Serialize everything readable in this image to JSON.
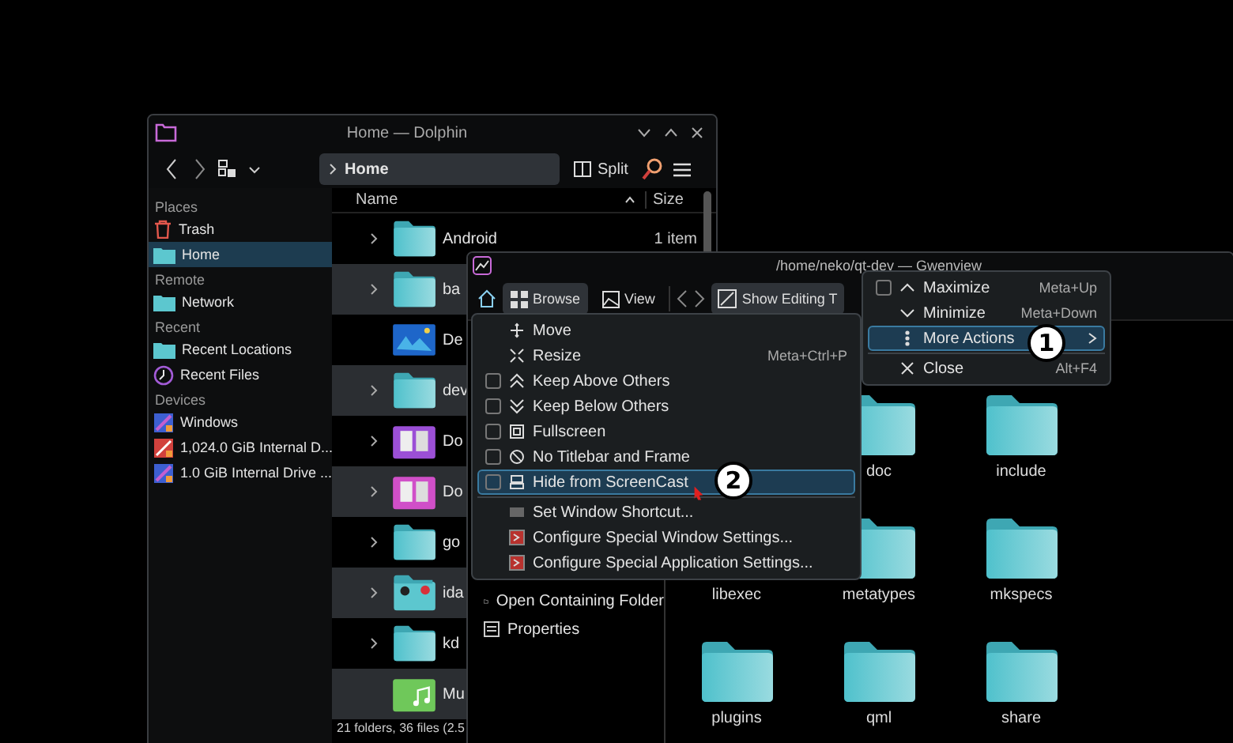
{
  "dolphin": {
    "title": "Home — Dolphin",
    "location": "Home",
    "split": "Split",
    "sidebar": [
      {
        "heading": "Places",
        "items": [
          {
            "label": "Trash",
            "kind": "trash",
            "selected": false
          },
          {
            "label": "Home",
            "kind": "folder",
            "selected": true
          }
        ]
      },
      {
        "heading": "Remote",
        "items": [
          {
            "label": "Network",
            "kind": "folder",
            "selected": false
          }
        ]
      },
      {
        "heading": "Recent",
        "items": [
          {
            "label": "Recent Locations",
            "kind": "folder",
            "selected": false
          },
          {
            "label": "Recent Files",
            "kind": "clock",
            "selected": false
          }
        ]
      },
      {
        "heading": "Devices",
        "items": [
          {
            "label": "Windows",
            "kind": "drive",
            "selected": false
          },
          {
            "label": "1,024.0 GiB Internal D...",
            "kind": "drive-red",
            "selected": false
          },
          {
            "label": "1.0 GiB Internal Drive ...",
            "kind": "drive",
            "selected": false
          }
        ]
      }
    ],
    "columns": [
      "Name",
      "Size"
    ],
    "rows": [
      {
        "name": "Android",
        "size": "1 item",
        "kind": "folder",
        "expandable": true
      },
      {
        "name": "ba",
        "kind": "folder",
        "expandable": true
      },
      {
        "name": "De",
        "kind": "image",
        "expandable": false
      },
      {
        "name": "dev",
        "kind": "folder",
        "expandable": true
      },
      {
        "name": "Do",
        "kind": "documents",
        "color": "#9b4fd6",
        "expandable": true
      },
      {
        "name": "Do",
        "kind": "documents",
        "color": "#d04fc8",
        "expandable": true
      },
      {
        "name": "go",
        "kind": "folder",
        "expandable": true
      },
      {
        "name": "ida",
        "kind": "folder-emblems",
        "expandable": true
      },
      {
        "name": "kd",
        "kind": "folder",
        "expandable": true
      },
      {
        "name": "Mu",
        "kind": "music",
        "expandable": false
      }
    ],
    "status": "21 folders, 36 files (2.5"
  },
  "gwenview": {
    "title": "/home/neko/qt-dev — Gwenview",
    "modes": [
      {
        "label": "Browse",
        "selected": true
      },
      {
        "label": "View",
        "selected": false
      }
    ],
    "editing": "Show Editing T",
    "side_items": [
      "Open Containing Folder",
      "Properties"
    ],
    "folder_rows": [
      [
        "doc",
        "include"
      ],
      [
        "libexec",
        "metatypes",
        "mkspecs"
      ],
      [
        "plugins",
        "qml",
        "share"
      ]
    ]
  },
  "window_menu": [
    {
      "kind": "check",
      "label": "Maximize",
      "shortcut": "Meta+Up",
      "checked": false,
      "selected": false
    },
    {
      "kind": "plain",
      "label": "Minimize",
      "shortcut": "Meta+Down",
      "selected": false
    },
    {
      "kind": "submenu",
      "label": "More Actions",
      "selected": true
    },
    {
      "kind": "separator"
    },
    {
      "kind": "plain",
      "label": "Close",
      "shortcut": "Alt+F4",
      "selected": false
    }
  ],
  "more_actions_menu": [
    {
      "kind": "plain",
      "label": "Move",
      "selected": false
    },
    {
      "kind": "plain",
      "label": "Resize",
      "shortcut": "Meta+Ctrl+P",
      "selected": false
    },
    {
      "kind": "check",
      "label": "Keep Above Others",
      "checked": false,
      "selected": false
    },
    {
      "kind": "check",
      "label": "Keep Below Others",
      "checked": false,
      "selected": false
    },
    {
      "kind": "check",
      "label": "Fullscreen",
      "checked": false,
      "selected": false
    },
    {
      "kind": "check",
      "label": "No Titlebar and Frame",
      "checked": false,
      "selected": false
    },
    {
      "kind": "check",
      "label": "Hide from ScreenCast",
      "checked": false,
      "selected": true
    },
    {
      "kind": "separator"
    },
    {
      "kind": "plain",
      "label": "Set Window Shortcut...",
      "selected": false
    },
    {
      "kind": "plain",
      "label": "Configure Special Window Settings...",
      "selected": false
    },
    {
      "kind": "plain",
      "label": "Configure Special Application Settings...",
      "selected": false
    }
  ],
  "badges": [
    {
      "label": "1"
    },
    {
      "label": "2"
    }
  ]
}
